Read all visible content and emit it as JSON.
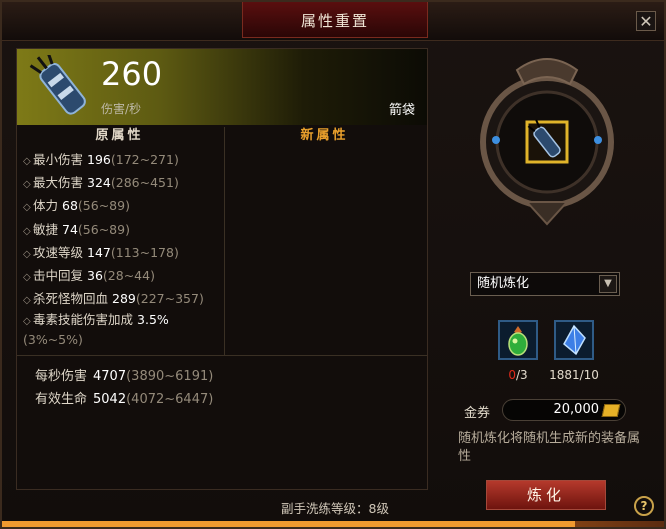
{
  "window": {
    "title": "属性重置",
    "close_glyph": "✕"
  },
  "item": {
    "dps": "260",
    "dps_label": "伤害/秒",
    "type": "箭袋",
    "icon": "quiver-icon"
  },
  "columns": {
    "original": "原属性",
    "new": "新属性"
  },
  "attributes": [
    {
      "name": "最小伤害",
      "value": "196",
      "range": "(172~271)"
    },
    {
      "name": "最大伤害",
      "value": "324",
      "range": "(286~451)"
    },
    {
      "name": "体力",
      "value": "68",
      "range": "(56~89)"
    },
    {
      "name": "敏捷",
      "value": "74",
      "range": "(56~89)"
    },
    {
      "name": "攻速等级",
      "value": "147",
      "range": "(113~178)"
    },
    {
      "name": "击中回复",
      "value": "36",
      "range": "(28~44)"
    },
    {
      "name": "杀死怪物回血",
      "value": "289",
      "range": "(227~357)"
    },
    {
      "name": "毒素技能伤害加成",
      "value": "3.5%",
      "range": "(3%~5%)"
    }
  ],
  "stats": [
    {
      "name": "每秒伤害",
      "value": "4707",
      "range": "(3890~6191)"
    },
    {
      "name": "有效生命",
      "value": "5042",
      "range": "(4072~6447)"
    }
  ],
  "footer": {
    "level_text": "副手洗练等级：8级"
  },
  "refine": {
    "mode_selected": "随机炼化",
    "materials": [
      {
        "icon": "green-gem-icon",
        "have": "0",
        "need": "/3"
      },
      {
        "icon": "blue-crystal-icon",
        "count": "1881/10"
      }
    ],
    "gold_label": "金券",
    "gold_value": "20,000",
    "description": "随机炼化将随机生成新的装备属性",
    "button_label": "炼化"
  },
  "help_glyph": "?",
  "progress": {
    "fraction": 0.86
  },
  "colors": {
    "accent_red": "#b5392c",
    "new_attr_orange": "#e9a02c",
    "gold": "#e6b127"
  }
}
